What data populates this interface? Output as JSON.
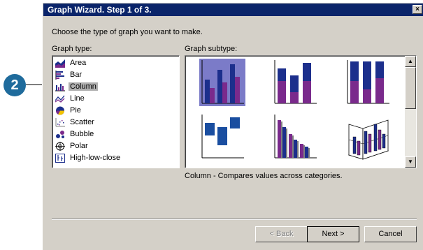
{
  "callout": {
    "number": "2"
  },
  "window": {
    "title": "Graph Wizard. Step 1 of 3.",
    "close": "×"
  },
  "instruction": "Choose the type of graph you want to make.",
  "graph_type": {
    "label": "Graph type:",
    "selected": "Column",
    "items": [
      {
        "label": "Area",
        "icon": "area-chart-icon"
      },
      {
        "label": "Bar",
        "icon": "bar-chart-icon"
      },
      {
        "label": "Column",
        "icon": "column-chart-icon"
      },
      {
        "label": "Line",
        "icon": "line-chart-icon"
      },
      {
        "label": "Pie",
        "icon": "pie-chart-icon"
      },
      {
        "label": "Scatter",
        "icon": "scatter-chart-icon"
      },
      {
        "label": "Bubble",
        "icon": "bubble-chart-icon"
      },
      {
        "label": "Polar",
        "icon": "polar-chart-icon"
      },
      {
        "label": "High-low-close",
        "icon": "high-low-close-chart-icon"
      }
    ]
  },
  "graph_subtype": {
    "label": "Graph subtype:",
    "description": "Column - Compares values across categories.",
    "thumbnails": [
      {
        "name": "clustered-column",
        "selected": true
      },
      {
        "name": "stacked-column",
        "selected": false
      },
      {
        "name": "percent-stacked-column",
        "selected": false
      },
      {
        "name": "floating-column",
        "selected": false
      },
      {
        "name": "bar-with-shadow",
        "selected": false
      },
      {
        "name": "3d-column",
        "selected": false
      }
    ]
  },
  "buttons": {
    "back": "< Back",
    "next": "Next >",
    "cancel": "Cancel"
  },
  "colors": {
    "navy": "#1c2f8c",
    "purple": "#7a2a8c",
    "blue": "#1a4ea0",
    "selection": "#7b7bc8",
    "title_bar": "#0a246a",
    "callout": "#1f6b9c"
  }
}
